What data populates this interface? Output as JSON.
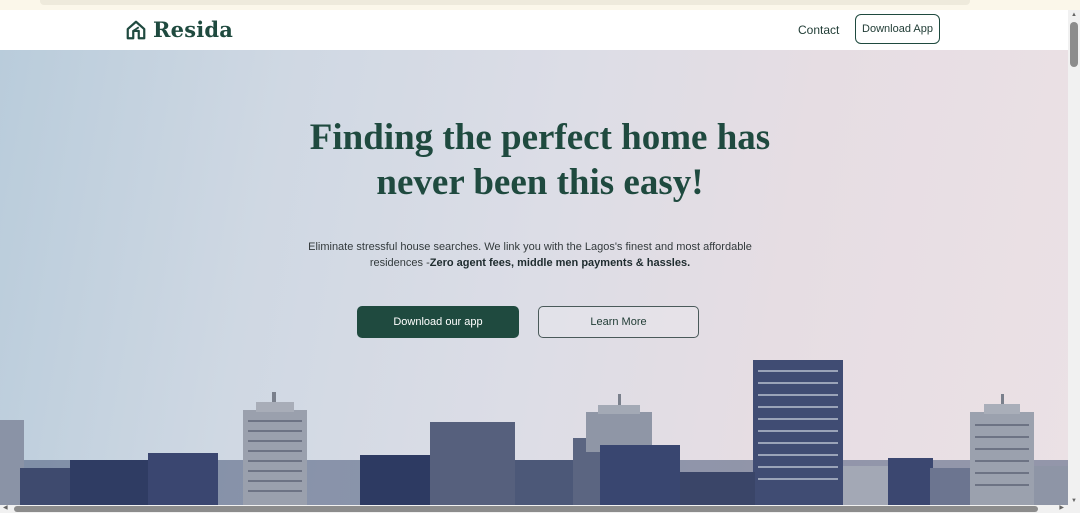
{
  "header": {
    "logo_text": "Resida",
    "logo_icon": "house-outline-icon",
    "nav_contact": "Contact",
    "nav_download": "Download App"
  },
  "hero": {
    "title_line1": "Finding the perfect home has",
    "title_line2": "never been this easy!",
    "subtitle_regular": "Eliminate stressful house searches. We link you with the Lagos's finest and most affordable residences -",
    "subtitle_bold": "Zero agent fees, middle men payments & hassles.",
    "primary_button": "Download our app",
    "secondary_button": "Learn More",
    "background_image": "lagos-city-skyline"
  },
  "colors": {
    "brand": "#1f4a3f",
    "primary_button_bg": "#1f4a3f",
    "text_dark": "#1f3b34"
  }
}
